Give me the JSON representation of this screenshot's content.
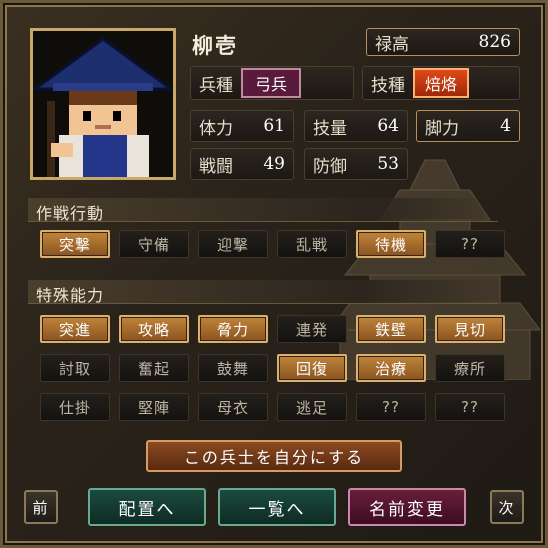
{
  "unit": {
    "name": "柳壱",
    "salary_label": "禄高",
    "salary": "826",
    "type_label": "兵種",
    "type": "弓兵",
    "skill_label": "技種",
    "skill": "焙烙",
    "stats": [
      {
        "label": "体力",
        "value": "61"
      },
      {
        "label": "技量",
        "value": "64"
      },
      {
        "label": "脚力",
        "value": "4"
      },
      {
        "label": "戦闘",
        "value": "49"
      },
      {
        "label": "防御",
        "value": "53"
      }
    ]
  },
  "tactics": {
    "title": "作戦行動",
    "items": [
      {
        "label": "突撃",
        "active": true
      },
      {
        "label": "守備",
        "active": false
      },
      {
        "label": "迎撃",
        "active": false
      },
      {
        "label": "乱戦",
        "active": false
      },
      {
        "label": "待機",
        "active": true
      },
      {
        "label": "??",
        "active": false
      }
    ]
  },
  "abilities": {
    "title": "特殊能力",
    "items": [
      {
        "label": "突進",
        "active": true
      },
      {
        "label": "攻略",
        "active": true
      },
      {
        "label": "脅力",
        "active": true
      },
      {
        "label": "連発",
        "active": false
      },
      {
        "label": "鉄壁",
        "active": true
      },
      {
        "label": "見切",
        "active": true
      },
      {
        "label": "討取",
        "active": false
      },
      {
        "label": "奮起",
        "active": false
      },
      {
        "label": "鼓舞",
        "active": false
      },
      {
        "label": "回復",
        "active": true
      },
      {
        "label": "治療",
        "active": true
      },
      {
        "label": "療所",
        "active": false
      },
      {
        "label": "仕掛",
        "active": false
      },
      {
        "label": "堅陣",
        "active": false
      },
      {
        "label": "母衣",
        "active": false
      },
      {
        "label": "逃足",
        "active": false
      },
      {
        "label": "??",
        "active": false
      },
      {
        "label": "??",
        "active": false
      }
    ]
  },
  "actions": {
    "own": "この兵士を自分にする",
    "prev": "前",
    "deploy": "配置へ",
    "list": "一覧へ",
    "rename": "名前変更",
    "next": "次"
  },
  "colors": {
    "active": "#b8782e",
    "inactive": "#1c1a16",
    "frame": "#6b5a3a"
  }
}
